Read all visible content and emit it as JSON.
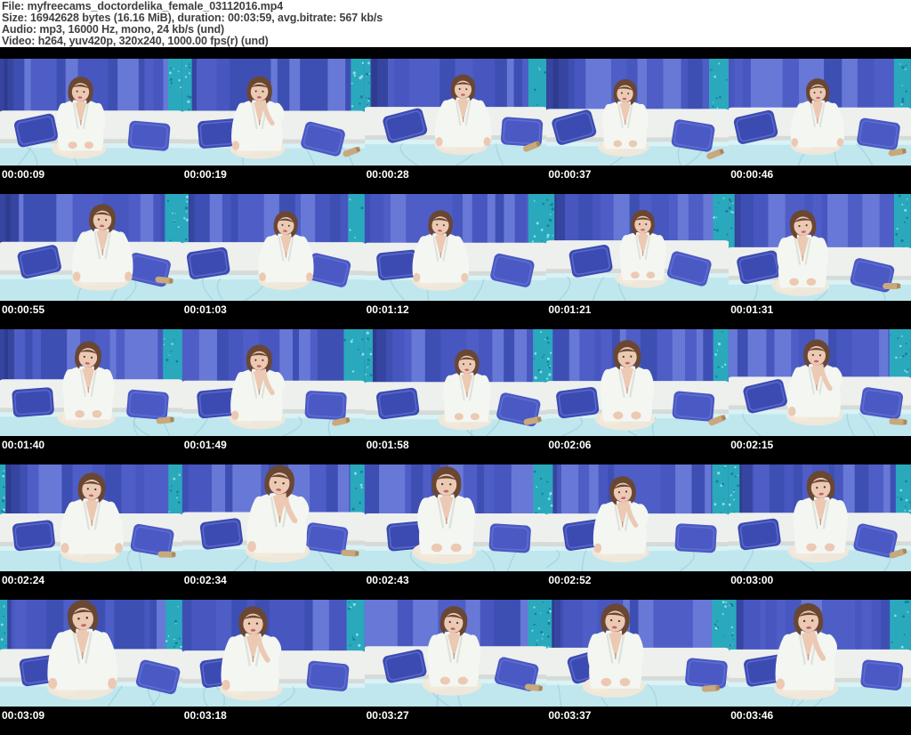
{
  "header": {
    "lines": [
      "File: myfreecams_doctordelika_female_03112016.mp4",
      "Size: 16942628 bytes (16.16 MiB), duration: 00:03:59, avg.bitrate: 567 kb/s",
      "Audio: mp3, 16000 Hz, mono, 24 kb/s (und)",
      "Video: h264, yuv420p, 320x240, 1000.00 fps(r) (und)"
    ]
  },
  "grid": {
    "columns": 5,
    "rows": 5
  },
  "thumbnails": [
    {
      "timestamp": "00:00:09"
    },
    {
      "timestamp": "00:00:19"
    },
    {
      "timestamp": "00:00:28"
    },
    {
      "timestamp": "00:00:37"
    },
    {
      "timestamp": "00:00:46"
    },
    {
      "timestamp": "00:00:55"
    },
    {
      "timestamp": "00:01:03"
    },
    {
      "timestamp": "00:01:12"
    },
    {
      "timestamp": "00:01:21"
    },
    {
      "timestamp": "00:01:31"
    },
    {
      "timestamp": "00:01:40"
    },
    {
      "timestamp": "00:01:49"
    },
    {
      "timestamp": "00:01:58"
    },
    {
      "timestamp": "00:02:06"
    },
    {
      "timestamp": "00:02:15"
    },
    {
      "timestamp": "00:02:24"
    },
    {
      "timestamp": "00:02:34"
    },
    {
      "timestamp": "00:02:43"
    },
    {
      "timestamp": "00:02:52"
    },
    {
      "timestamp": "00:03:00"
    },
    {
      "timestamp": "00:03:09"
    },
    {
      "timestamp": "00:03:18"
    },
    {
      "timestamp": "00:03:27"
    },
    {
      "timestamp": "00:03:37"
    },
    {
      "timestamp": "00:03:46"
    }
  ],
  "colors": {
    "page_background": "#000000",
    "header_background": "#ffffff",
    "header_text": "#3f3f3f",
    "timestamp_text": "#ffffff",
    "curtain_blue": "#4e5ec6",
    "curtain_blue_dark": "#3e4fb4",
    "curtain_blue_mid": "#4757bf",
    "curtain_blue_light": "#6878d6",
    "curtain_left_dark": "#36459f",
    "curtain_teal": "#2aa9bd",
    "teal_speckle_light": "#8fdde6",
    "teal_speckle_dark": "#157f9a",
    "couch_white": "#eef0ee",
    "couch_shadow": "#d6dbd8",
    "blanket_cyan": "#c0e7ee",
    "blanket_highlight": "#d9f2f6",
    "pillow_blue_left": "#3c4bb2",
    "pillow_blue_right": "#4a59c4",
    "bottle_tan": "#c9a87c",
    "shirt_white": "#f4f6f2",
    "hair_brown": "#6a4733",
    "skin_tone": "#ecc9b3"
  }
}
